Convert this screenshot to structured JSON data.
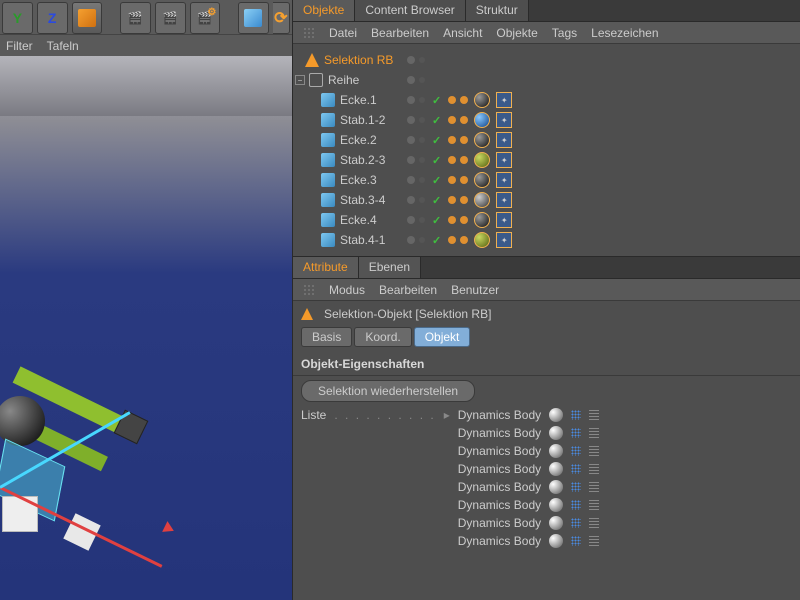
{
  "toolbar2": {
    "filter": "Filter",
    "tafeln": "Tafeln"
  },
  "top_tabs": {
    "objekte": "Objekte",
    "content_browser": "Content Browser",
    "struktur": "Struktur"
  },
  "obj_menu": {
    "datei": "Datei",
    "bearbeiten": "Bearbeiten",
    "ansicht": "Ansicht",
    "objekte": "Objekte",
    "tags": "Tags",
    "lesezeichen": "Lesezeichen"
  },
  "tree": {
    "selektion": "Selektion RB",
    "reihe": "Reihe",
    "items": [
      {
        "name": "Ecke.1",
        "sphere": "dark"
      },
      {
        "name": "Stab.1-2",
        "sphere": "blue"
      },
      {
        "name": "Ecke.2",
        "sphere": "dark"
      },
      {
        "name": "Stab.2-3",
        "sphere": "olive"
      },
      {
        "name": "Ecke.3",
        "sphere": "dark"
      },
      {
        "name": "Stab.3-4",
        "sphere": "gray"
      },
      {
        "name": "Ecke.4",
        "sphere": "dark"
      },
      {
        "name": "Stab.4-1",
        "sphere": "olive"
      }
    ]
  },
  "attr_tabs": {
    "attribute": "Attribute",
    "ebenen": "Ebenen"
  },
  "attr_menu": {
    "modus": "Modus",
    "bearbeiten": "Bearbeiten",
    "benutzer": "Benutzer"
  },
  "attr_title": "Selektion-Objekt [Selektion RB]",
  "mode_tabs": {
    "basis": "Basis",
    "koord": "Koord.",
    "objekt": "Objekt"
  },
  "section_title": "Objekt-Eigenschaften",
  "restore_btn": "Selektion wiederherstellen",
  "liste_label": "Liste",
  "dyn_body": "Dynamics Body",
  "dyn_count": 8
}
